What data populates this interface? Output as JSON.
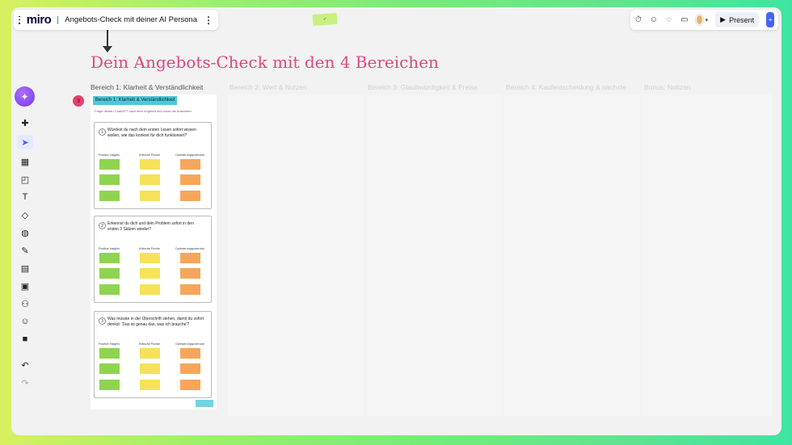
{
  "header": {
    "app_logo": "miro",
    "board_name": "Angebots-Check mit deiner AI Persona",
    "more_icon": "⋮",
    "present_label": "Present",
    "icons": [
      "timer-icon",
      "reactions-icon",
      "chat-icon",
      "video-icon",
      "avatar",
      "share-icon"
    ]
  },
  "canvas": {
    "title": "Dein Angebots-Check mit den 4 Bereichen",
    "badge": "3",
    "section_labels": [
      "Bereich 1: Klarheit & Verständlichkeit",
      "Bereich 2: Wert & Nutzen",
      "Bereich 3: Glaubwürdigkeit & Preise",
      "Bereich 4: Kaufentscheidung & nächste",
      "Bonus: Notizen"
    ],
    "board1": {
      "header": "Bereich 1: Klarheit & Verständlichkeit",
      "hint": "Frage deinen ChatGPT nach dem Angebot und nutze die Antworten",
      "columns": [
        "Positive Insights",
        "Kritische Punkte",
        "Optimierungspotenzial"
      ],
      "questions": [
        {
          "num": "1",
          "text": "Würdest du nach dem ersten Lesen sofort wissen wollen, wie das konkret für dich funktioniert?"
        },
        {
          "num": "2",
          "text": "Erkennst du dich und dein Problem sofort in den ersten 3 Sätzen wieder?"
        },
        {
          "num": "3",
          "text": "Was müsste in der Überschrift stehen, damit du sofort denkst: 'Das ist genau das, was ich brauche'?"
        }
      ]
    }
  },
  "colors": {
    "accent": "#e0477e",
    "brand": "#4262ff",
    "teal": "#50c8d8"
  }
}
